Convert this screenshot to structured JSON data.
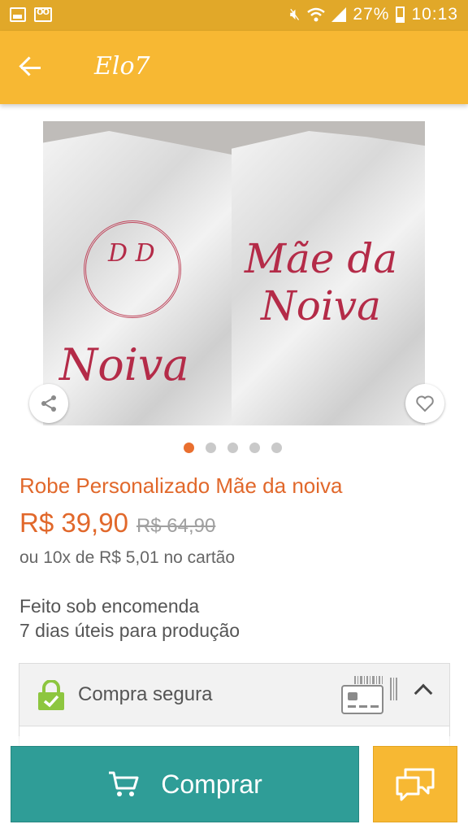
{
  "status_bar": {
    "battery": "27%",
    "time": "10:13",
    "icons": [
      "image-icon",
      "voicemail-icon",
      "mute-icon",
      "wifi-icon",
      "signal-icon",
      "battery-icon"
    ]
  },
  "app_bar": {
    "title": "Elo7",
    "back_icon": "arrow-back-icon"
  },
  "gallery": {
    "image_embroidery": {
      "left_robe_monogram": "D D",
      "left_robe_text": "Noiva",
      "right_robe_text": "Mãe da Noiva"
    },
    "total_images": 5,
    "active_index": 0,
    "share_icon": "share-icon",
    "favorite_icon": "heart-outline-icon"
  },
  "product": {
    "title": "Robe Personalizado Mãe da noiva",
    "price": "R$ 39,90",
    "old_price": "R$ 64,90",
    "installments": "ou 10x de R$ 5,01 no cartão",
    "production_line1": "Feito sob encomenda",
    "production_line2": "7 dias úteis para produção"
  },
  "secure_panel": {
    "label": "Compra segura",
    "icons": [
      "lock-check-icon",
      "credit-card-icon",
      "chevron-up-icon"
    ]
  },
  "actions": {
    "buy_label": "Comprar",
    "buy_icon": "cart-icon",
    "chat_icon": "chat-bubbles-icon"
  },
  "colors": {
    "status_bar": "#e1a829",
    "app_bar": "#f7b833",
    "accent_orange": "#e1682b",
    "buy_button": "#2f9d97",
    "secure_lock": "#8dc63f"
  }
}
